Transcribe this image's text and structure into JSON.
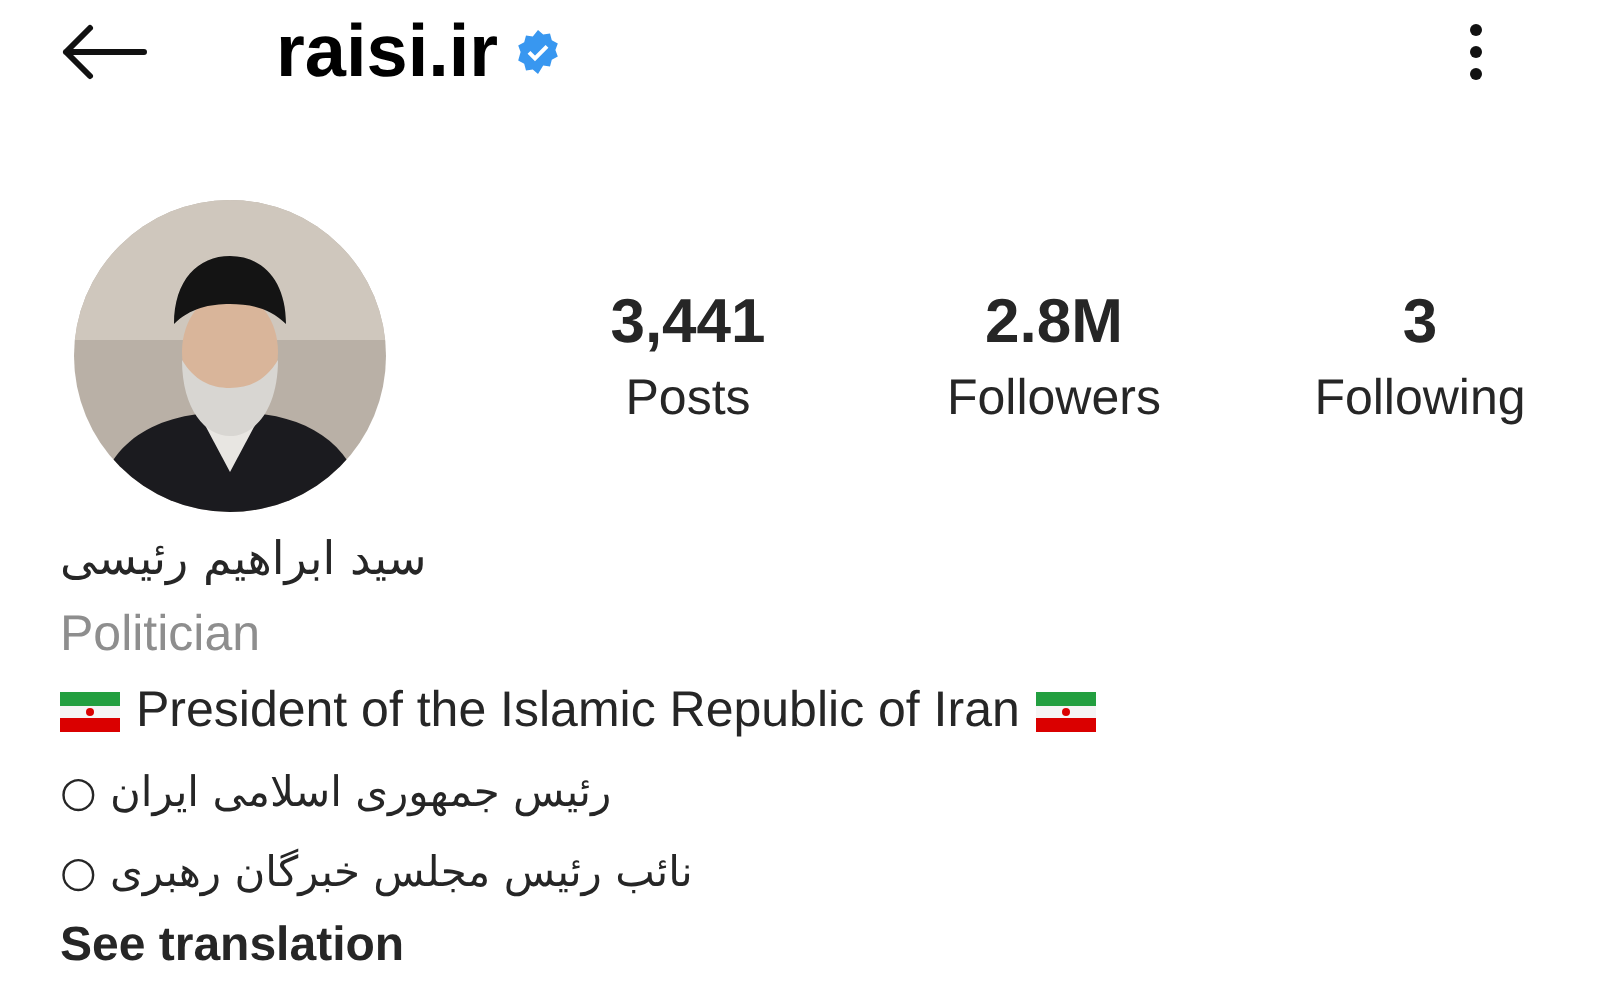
{
  "header": {
    "username": "raisi.ir",
    "verified": true
  },
  "stats": [
    {
      "value": "3,441",
      "label": "Posts"
    },
    {
      "value": "2.8M",
      "label": "Followers"
    },
    {
      "value": "3",
      "label": "Following"
    }
  ],
  "profile": {
    "name": "سید ابراهیم رئیسی",
    "category": "Politician",
    "bio": [
      {
        "kind": "flagged",
        "text": "President of the Islamic Republic of Iran"
      },
      {
        "kind": "rtl",
        "text": "رئیس جمهوری اسلامی ایران ○"
      },
      {
        "kind": "rtl",
        "text": "نائب رئیس مجلس خبرگان رهبری ○"
      }
    ],
    "see_translation": "See translation"
  }
}
